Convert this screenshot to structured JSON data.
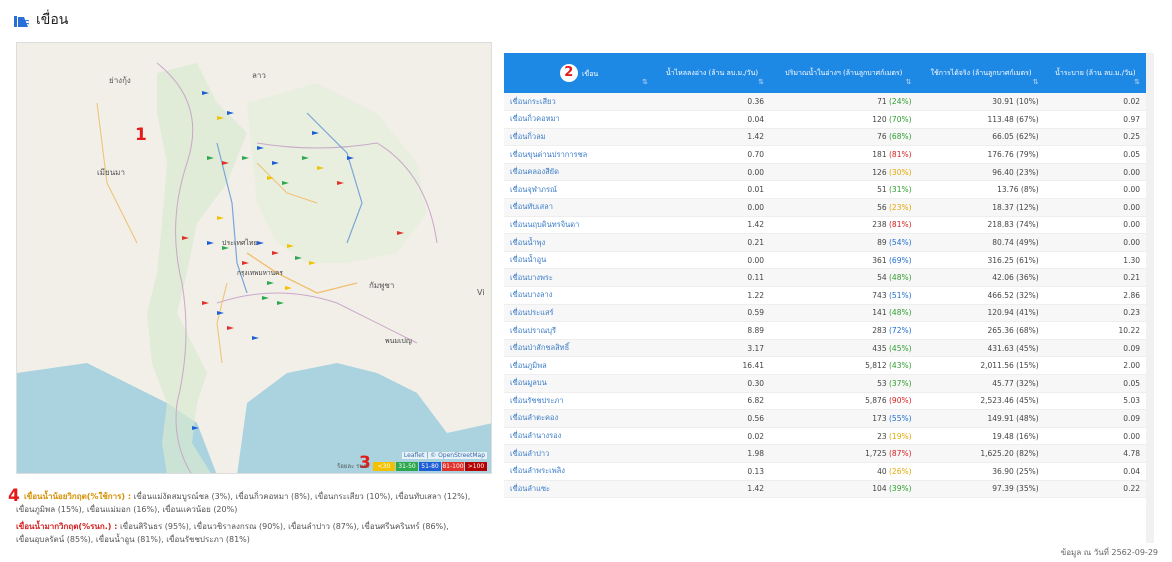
{
  "page": {
    "title": "เขื่อน",
    "footer": "ข้อมูล ณ วันที่ 2562-09-29"
  },
  "map": {
    "labels": {
      "country_w": "เมียนมา",
      "laos": "ลาว",
      "vietnam": "Vi",
      "cambodia": "กัมพูชา",
      "city_center": "ประเทศไทย",
      "bangkok": "กรุงเทพมหานคร",
      "phnom": "พนมเปญ",
      "north": "ย่างกุ้ง"
    },
    "attribution": "Leaflet | © OpenStreetMap",
    "legend": {
      "title": "ร้อยละ รนก.",
      "items": [
        {
          "label": "<30",
          "color": "#f2c200"
        },
        {
          "label": "31-50",
          "color": "#2ea84f"
        },
        {
          "label": "51-80",
          "color": "#1f5fd6"
        },
        {
          "label": "81-100",
          "color": "#e0312b"
        },
        {
          "label": ">100",
          "color": "#b40000"
        }
      ]
    }
  },
  "callouts": [
    "1",
    "2",
    "3",
    "4"
  ],
  "notes": {
    "low_title": "เขื่อนน้ำน้อยวิกฤต(%ใช้การ) :",
    "low_text": "เขื่อนแม่งัดสมบูรณ์ชล (3%), เขื่อนกิ่วคอหมา (8%), เขื่อนกระเสียว (10%), เขื่อนทับเสลา (12%),",
    "low_text2": "เขื่อนภูมิพล (15%), เขื่อนแม่มอก (16%), เขื่อนแควน้อย (20%)",
    "high_title": "เขื่อนน้ำมากวิกฤต(%รนก.) :",
    "high_text": "เขื่อนสิรินธร (95%), เขื่อนวชิราลงกรณ (90%), เขื่อนลำปาว (87%), เขื่อนศรีนครินทร์ (86%),",
    "high_text2": "เขื่อนอุบลรัตน์ (85%), เขื่อนน้ำอูน (81%), เขื่อนรัชชประภา (81%)"
  },
  "table": {
    "headers": [
      "เขื่อน",
      "น้ำไหลลงอ่าง (ล้าน ลบ.ม./วัน)",
      "ปริมาณน้ำในอ่างฯ (ล้านลูกบาศก์เมตร)",
      "ใช้การได้จริง (ล้านลูกบาศก์เมตร)",
      "น้ำระบาย (ล้าน ลบ.ม./วัน)"
    ],
    "rows": [
      {
        "name": "เขื่อนกระเสียว",
        "inflow": "0.36",
        "storage": "71",
        "pct": "(24%)",
        "pcls": "pg",
        "usable": "30.91 (10%)",
        "release": "0.02"
      },
      {
        "name": "เขื่อนกิ่วคอหมา",
        "inflow": "0.04",
        "storage": "120",
        "pct": "(70%)",
        "pcls": "pg",
        "usable": "113.48 (67%)",
        "release": "0.97"
      },
      {
        "name": "เขื่อนกิ่วลม",
        "inflow": "1.42",
        "storage": "76",
        "pct": "(68%)",
        "pcls": "pg",
        "usable": "66.05 (62%)",
        "release": "0.25"
      },
      {
        "name": "เขื่อนขุนด่านปราการชล",
        "inflow": "0.70",
        "storage": "181",
        "pct": "(81%)",
        "pcls": "pr",
        "usable": "176.76 (79%)",
        "release": "0.05"
      },
      {
        "name": "เขื่อนคลองสียัด",
        "inflow": "0.00",
        "storage": "126",
        "pct": "(30%)",
        "pcls": "po",
        "usable": "96.40 (23%)",
        "release": "0.00"
      },
      {
        "name": "เขื่อนจุฬาภรณ์",
        "inflow": "0.01",
        "storage": "51",
        "pct": "(31%)",
        "pcls": "pg",
        "usable": "13.76 (8%)",
        "release": "0.00"
      },
      {
        "name": "เขื่อนทับเสลา",
        "inflow": "0.00",
        "storage": "56",
        "pct": "(23%)",
        "pcls": "po",
        "usable": "18.37 (12%)",
        "release": "0.00"
      },
      {
        "name": "เขื่อนนฤบดินทรจินดา",
        "inflow": "1.42",
        "storage": "238",
        "pct": "(81%)",
        "pcls": "pr",
        "usable": "218.83 (74%)",
        "release": "0.00"
      },
      {
        "name": "เขื่อนน้ำพุง",
        "inflow": "0.21",
        "storage": "89",
        "pct": "(54%)",
        "pcls": "pb",
        "usable": "80.74 (49%)",
        "release": "0.00"
      },
      {
        "name": "เขื่อนน้ำอูน",
        "inflow": "0.00",
        "storage": "361",
        "pct": "(69%)",
        "pcls": "pb",
        "usable": "316.25 (61%)",
        "release": "1.30"
      },
      {
        "name": "เขื่อนบางพระ",
        "inflow": "0.11",
        "storage": "54",
        "pct": "(48%)",
        "pcls": "pg",
        "usable": "42.06 (36%)",
        "release": "0.21"
      },
      {
        "name": "เขื่อนบางลาง",
        "inflow": "1.22",
        "storage": "743",
        "pct": "(51%)",
        "pcls": "pb",
        "usable": "466.52 (32%)",
        "release": "2.86"
      },
      {
        "name": "เขื่อนประแสร์",
        "inflow": "0.59",
        "storage": "141",
        "pct": "(48%)",
        "pcls": "pg",
        "usable": "120.94 (41%)",
        "release": "0.23"
      },
      {
        "name": "เขื่อนปราณบุรี",
        "inflow": "8.89",
        "storage": "283",
        "pct": "(72%)",
        "pcls": "pb",
        "usable": "265.36 (68%)",
        "release": "10.22"
      },
      {
        "name": "เขื่อนป่าสักชลสิทธิ์",
        "inflow": "3.17",
        "storage": "435",
        "pct": "(45%)",
        "pcls": "pg",
        "usable": "431.63 (45%)",
        "release": "0.09"
      },
      {
        "name": "เขื่อนภูมิพล",
        "inflow": "16.41",
        "storage": "5,812",
        "pct": "(43%)",
        "pcls": "pg",
        "usable": "2,011.56 (15%)",
        "release": "2.00"
      },
      {
        "name": "เขื่อนมูลบน",
        "inflow": "0.30",
        "storage": "53",
        "pct": "(37%)",
        "pcls": "pg",
        "usable": "45.77 (32%)",
        "release": "0.05"
      },
      {
        "name": "เขื่อนรัชชประภา",
        "inflow": "6.82",
        "storage": "5,876",
        "pct": "(90%)",
        "pcls": "pr",
        "usable": "2,523.46 (45%)",
        "release": "5.03"
      },
      {
        "name": "เขื่อนลำตะคอง",
        "inflow": "0.56",
        "storage": "173",
        "pct": "(55%)",
        "pcls": "pb",
        "usable": "149.91 (48%)",
        "release": "0.09"
      },
      {
        "name": "เขื่อนลำนางรอง",
        "inflow": "0.02",
        "storage": "23",
        "pct": "(19%)",
        "pcls": "po",
        "usable": "19.48 (16%)",
        "release": "0.00"
      },
      {
        "name": "เขื่อนลำปาว",
        "inflow": "1.98",
        "storage": "1,725",
        "pct": "(87%)",
        "pcls": "pr",
        "usable": "1,625.20 (82%)",
        "release": "4.78"
      },
      {
        "name": "เขื่อนลำพระเพลิง",
        "inflow": "0.13",
        "storage": "40",
        "pct": "(26%)",
        "pcls": "po",
        "usable": "36.90 (25%)",
        "release": "0.04"
      },
      {
        "name": "เขื่อนลำแซะ",
        "inflow": "1.42",
        "storage": "104",
        "pct": "(39%)",
        "pcls": "pg",
        "usable": "97.39 (35%)",
        "release": "0.22"
      }
    ]
  }
}
